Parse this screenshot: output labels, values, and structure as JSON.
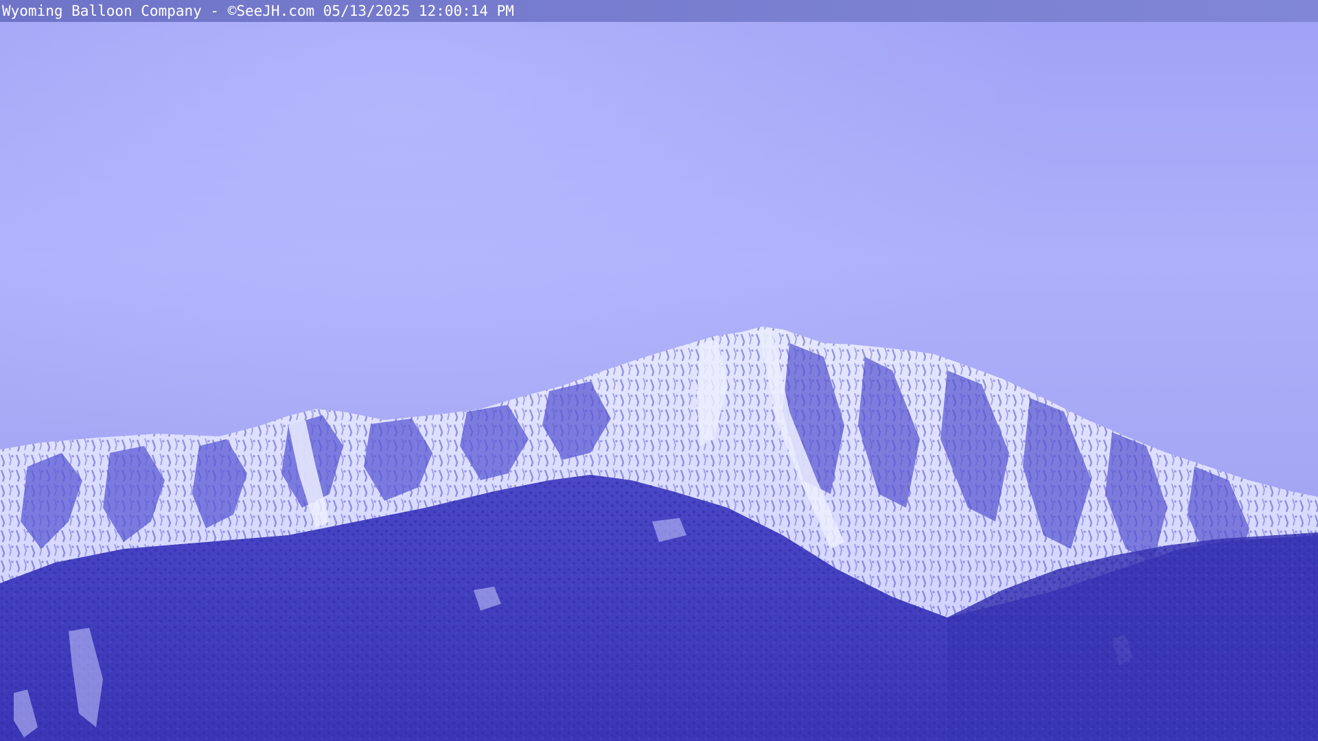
{
  "overlay": {
    "caption": "Wyoming Balloon Company - ©SeeJH.com 05/13/2025 12:00:14 PM"
  },
  "colors": {
    "sky_top": "#9fa1f5",
    "sky_mid": "#aeb0fb",
    "sky_bottom": "#9da0f0",
    "snow": "#dfe2ff",
    "rock": "#5a5cd0",
    "forest_dark": "#3a37b8",
    "forest_mid": "#4845c4",
    "caption_bar": "#7378cc",
    "caption_text": "#ffffff"
  },
  "scene": {
    "subject": "snow-covered-mountain-peak",
    "icons": [
      "webcam-frame"
    ]
  }
}
